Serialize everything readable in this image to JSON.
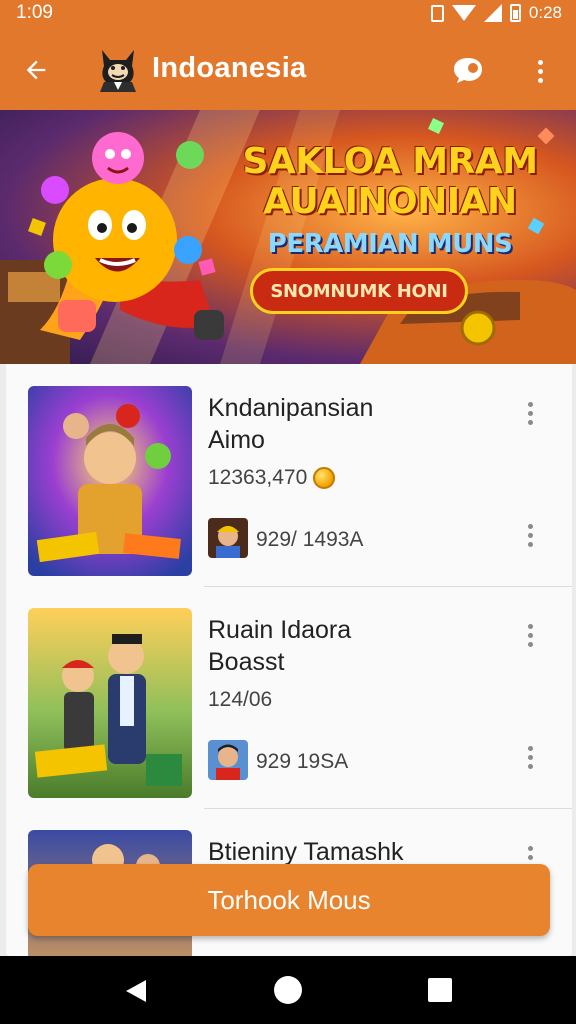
{
  "status_bar": {
    "time": "1:09",
    "battery_text": "0:28"
  },
  "app_bar": {
    "title": "Indoanesia",
    "back_icon": "arrow-back-icon",
    "chat_icon": "chat-bubble-icon",
    "more_icon": "more-vert-icon"
  },
  "banner": {
    "line1": "SAKLOA MRAM",
    "line2": "AUAINONIAN",
    "line3": "PERAMIAN MUNS",
    "cta": "SNOMNUMK HONI"
  },
  "items": [
    {
      "title": "Kndanipansian",
      "subtitle": "Aimo",
      "count": "12363,470",
      "stat": "929/ 1493A"
    },
    {
      "title": "Ruain Idaora",
      "subtitle": "Boasst",
      "count": "124/06",
      "stat": "929 19SA"
    },
    {
      "title": "Btieniny Tamashk",
      "subtitle": "",
      "count": "",
      "stat": ""
    }
  ],
  "primary_button": {
    "label": "Torhook Mous"
  },
  "colors": {
    "primary": "#e2782b",
    "button": "#e8832e",
    "nav_bar": "#000000"
  }
}
